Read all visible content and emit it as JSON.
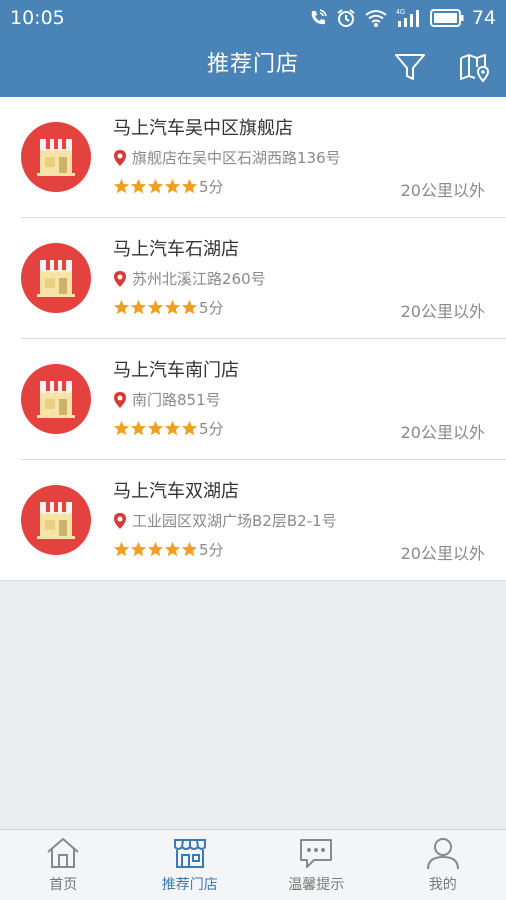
{
  "status_bar": {
    "time": "10:05",
    "battery": "74",
    "network": "4G"
  },
  "header": {
    "title": "推荐门店",
    "filter_icon": "filter-icon",
    "map_icon": "map-icon"
  },
  "colors": {
    "brand": "#4a83b5",
    "avatar": "#e4423f",
    "star": "#f0a020",
    "tab_active": "#3a79b4"
  },
  "stores": [
    {
      "name": "马上汽车吴中区旗舰店",
      "address": "旗舰店在吴中区石湖西路136号",
      "rating": 5,
      "rating_text": "5分",
      "distance": "20公里以外"
    },
    {
      "name": "马上汽车石湖店",
      "address": "苏州北溪江路260号",
      "rating": 5,
      "rating_text": "5分",
      "distance": "20公里以外"
    },
    {
      "name": "马上汽车南门店",
      "address": "南门路851号",
      "rating": 5,
      "rating_text": "5分",
      "distance": "20公里以外"
    },
    {
      "name": "马上汽车双湖店",
      "address": "工业园区双湖广场B2层B2-1号",
      "rating": 5,
      "rating_text": "5分",
      "distance": "20公里以外"
    }
  ],
  "tabs": [
    {
      "label": "首页",
      "icon": "home-icon",
      "active": false
    },
    {
      "label": "推荐门店",
      "icon": "store-icon",
      "active": true
    },
    {
      "label": "温馨提示",
      "icon": "message-icon",
      "active": false
    },
    {
      "label": "我的",
      "icon": "user-icon",
      "active": false
    }
  ]
}
